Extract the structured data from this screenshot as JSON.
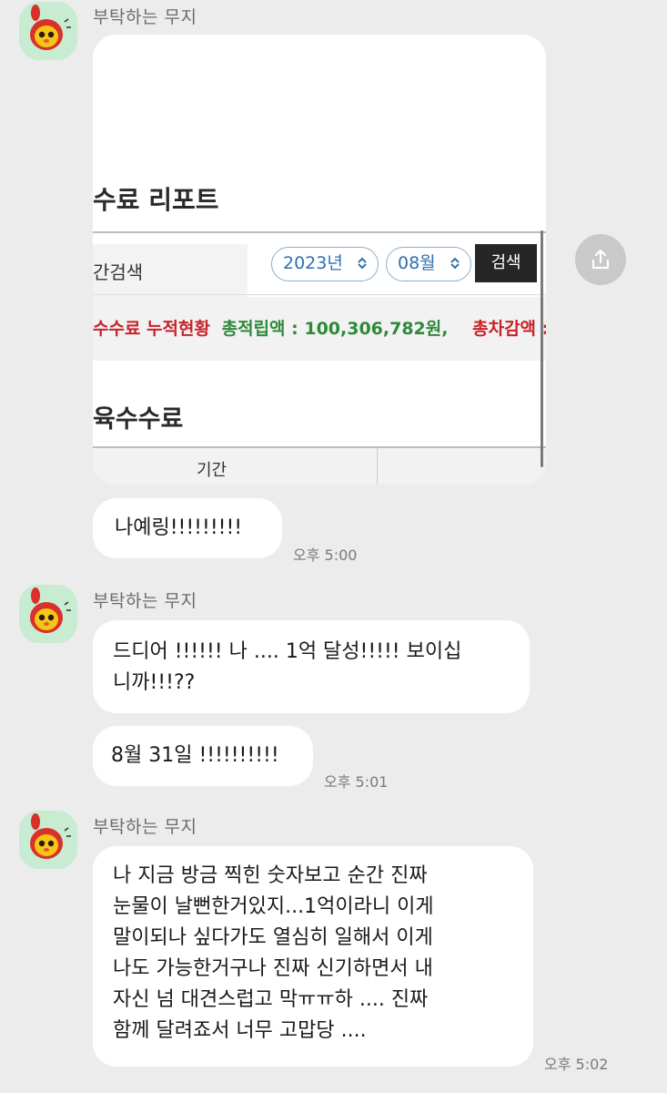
{
  "sender_name": "부탁하는 무지",
  "image_message": {
    "report_title": "수료 리포트",
    "period_label": "간검색",
    "year_select": "2023년",
    "month_select": "08월",
    "search_button": "검색",
    "summary_title": "수수료 누적현황",
    "summary_total_label": "총적립액 : 100,306,782원,",
    "summary_deduct_label": "총차감액 : ",
    "section2_title": "육수수료",
    "table_col_period": "기간"
  },
  "messages": [
    {
      "lines": [
        "나예링!!!!!!!!!"
      ],
      "time": "오후 5:00"
    },
    {
      "lines": [
        "드디어 !!!!!! 나 .... 1억 달성!!!!! 보이십",
        "니까!!!??"
      ]
    },
    {
      "lines": [
        "8월 31일 !!!!!!!!!!"
      ],
      "time": "오후 5:01"
    },
    {
      "lines": [
        "나 지금 방금 찍힌 숫자보고 순간 진짜",
        "눈물이 날뻔한거있지...1억이라니 이게",
        "말이되나 싶다가도 열심히 일해서 이게",
        "나도 가능한거구나 진짜 신기하면서 내",
        "자신 넘 대견스럽고 막ㅠㅠ하 .... 진짜",
        "함께 달려죠서 너무 고맙당 ...."
      ],
      "time": "오후 5:02"
    }
  ],
  "icons": {
    "avatar": "muji-character-avatar",
    "share": "share-icon",
    "chevron": "chevron-updown-icon"
  },
  "colors": {
    "background": "#ececec",
    "bubble": "#ffffff",
    "avatar_bg": "#c7ecd2",
    "report_red": "#c8222a",
    "report_green": "#2e8a3a"
  }
}
